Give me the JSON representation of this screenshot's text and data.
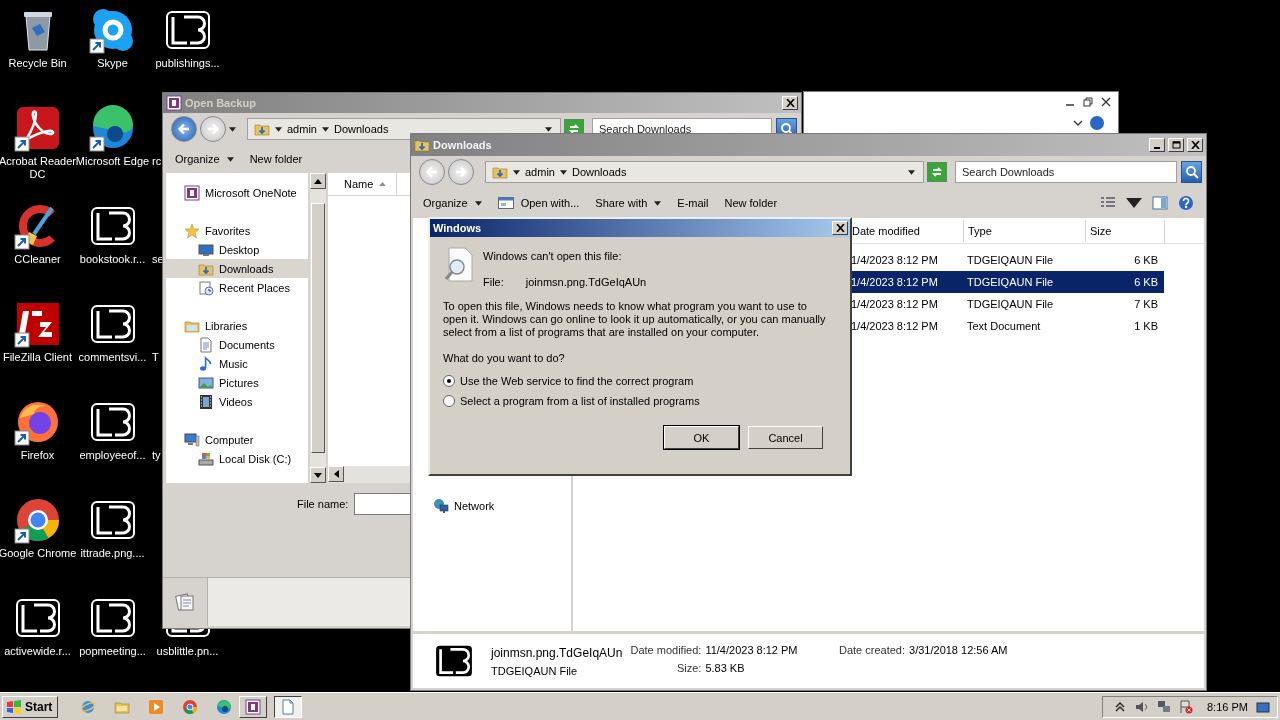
{
  "desktop": {
    "columns": [
      [
        {
          "label": "Recycle Bin",
          "kind": "recycle",
          "shortcut": false
        },
        {
          "label": "Acrobat Reader DC",
          "kind": "acrobat",
          "shortcut": true
        },
        {
          "label": "CCleaner",
          "kind": "ccleaner",
          "shortcut": true
        },
        {
          "label": "FileZilla Client",
          "kind": "filezilla",
          "shortcut": true
        },
        {
          "label": "Firefox",
          "kind": "firefox",
          "shortcut": true
        },
        {
          "label": "Google Chrome",
          "kind": "chrome",
          "shortcut": true
        },
        {
          "label": "activewide.r...",
          "kind": "document",
          "shortcut": false
        }
      ],
      [
        {
          "label": "Skype",
          "kind": "skype",
          "shortcut": true
        },
        {
          "label": "Microsoft Edge",
          "kind": "edge",
          "shortcut": true
        },
        {
          "label": "bookstook.r...",
          "kind": "document",
          "shortcut": false
        },
        {
          "label": "commentsvi...",
          "kind": "document",
          "shortcut": false
        },
        {
          "label": "employeeof...",
          "kind": "document",
          "shortcut": false
        },
        {
          "label": "ittrade.png....",
          "kind": "document",
          "shortcut": false
        },
        {
          "label": "popmeeting...",
          "kind": "document",
          "shortcut": false
        }
      ],
      [
        {
          "label": "publishings...",
          "kind": "document",
          "shortcut": false
        },
        {
          "label": "rc",
          "kind": "partial"
        },
        {
          "label": "se",
          "kind": "partial"
        },
        {
          "label": "T",
          "kind": "partial"
        },
        {
          "label": "ty",
          "kind": "partial"
        },
        {
          "label": "usblittle.pn...",
          "kind": "document",
          "shortcut": false
        }
      ]
    ]
  },
  "open_backup": {
    "title": "Open Backup",
    "path": [
      "admin",
      "Downloads"
    ],
    "search_placeholder": "Search Downloads",
    "toolbar": [
      {
        "label": "Organize",
        "kind": "menu"
      },
      {
        "label": "New folder",
        "kind": "plain"
      }
    ],
    "nav": [
      {
        "label": "Microsoft OneNote",
        "kind": "onenote",
        "selected": false
      },
      {
        "label": "Favorites",
        "kind": "star",
        "selected": false,
        "children": [
          {
            "label": "Desktop",
            "kind": "desktop",
            "selected": false
          },
          {
            "label": "Downloads",
            "kind": "downloads",
            "selected": true
          },
          {
            "label": "Recent Places",
            "kind": "recent",
            "selected": false
          }
        ]
      },
      {
        "label": "Libraries",
        "kind": "libraries",
        "selected": false,
        "children": [
          {
            "label": "Documents",
            "kind": "documents",
            "selected": false
          },
          {
            "label": "Music",
            "kind": "music",
            "selected": false
          },
          {
            "label": "Pictures",
            "kind": "pictures",
            "selected": false
          },
          {
            "label": "Videos",
            "kind": "videos",
            "selected": false
          }
        ]
      },
      {
        "label": "Computer",
        "kind": "computer",
        "selected": false,
        "children": [
          {
            "label": "Local Disk (C:)",
            "kind": "disk",
            "selected": false
          }
        ]
      }
    ],
    "columns": [
      "Name"
    ],
    "file_name_label": "File name:"
  },
  "downloads": {
    "title": "Downloads",
    "path": [
      "admin",
      "Downloads"
    ],
    "search_placeholder": "Search Downloads",
    "toolbar": [
      {
        "label": "Organize",
        "kind": "menu"
      },
      {
        "label": "Open with...",
        "kind": "app"
      },
      {
        "label": "Share with",
        "kind": "menu"
      },
      {
        "label": "E-mail",
        "kind": "plain"
      },
      {
        "label": "New folder",
        "kind": "plain"
      }
    ],
    "nav": [
      {
        "label": "Network",
        "kind": "network",
        "selected": false
      }
    ],
    "columns": [
      "Date modified",
      "Type",
      "Size"
    ],
    "rows": [
      {
        "date": "1/4/2023 8:12 PM",
        "type": "TDGEIQAUN File",
        "size": "6 KB",
        "selected": false
      },
      {
        "date": "1/4/2023 8:12 PM",
        "type": "TDGEIQAUN File",
        "size": "6 KB",
        "selected": true
      },
      {
        "date": "1/4/2023 8:12 PM",
        "type": "TDGEIQAUN File",
        "size": "7 KB",
        "selected": false
      },
      {
        "date": "1/4/2023 8:12 PM",
        "type": "Text Document",
        "size": "1 KB",
        "selected": false
      }
    ],
    "details": {
      "name": "joinmsn.png.TdGeIqAUn",
      "type": "TDGEIQAUN File",
      "columns": [
        [
          {
            "label": "Date modified:",
            "value": "11/4/2023 8:12 PM"
          },
          {
            "label": "Size:",
            "value": "5.83 KB"
          }
        ],
        [
          {
            "label": "Date created:",
            "value": "3/31/2018 12:56 AM"
          }
        ]
      ]
    }
  },
  "dialog": {
    "title": "Windows",
    "heading": "Windows can't open this file:",
    "file_label": "File:",
    "file_name": "joinmsn.png.TdGeIqAUn",
    "body": "To open this file, Windows needs to know what program you want to use to open it. Windows can go online to look it up automatically, or you can manually select from a list of programs that are installed on your computer.",
    "question": "What do you want to do?",
    "options": [
      {
        "label": "Use the Web service to find the correct program",
        "selected": true
      },
      {
        "label": "Select a program from a list of installed programs",
        "selected": false
      }
    ],
    "buttons": [
      {
        "label": "OK",
        "default": true
      },
      {
        "label": "Cancel",
        "default": false
      }
    ]
  },
  "taskbar": {
    "start": "Start",
    "quick_launch": [
      {
        "kind": "ie"
      },
      {
        "kind": "explorer"
      },
      {
        "kind": "media"
      },
      {
        "kind": "chrome"
      },
      {
        "kind": "edge"
      }
    ],
    "tasks": [
      {
        "kind": "onenote",
        "active": false
      },
      {
        "kind": "notepad",
        "active": true
      }
    ],
    "clock": "8:16 PM"
  }
}
